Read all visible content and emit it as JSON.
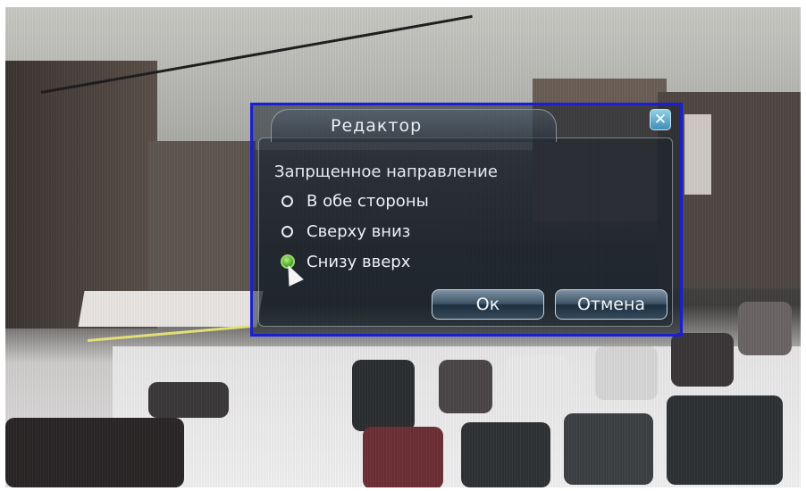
{
  "dialog": {
    "title": "Редактор",
    "close_icon": "close-icon",
    "section_label": "Запрщенное направление",
    "options": [
      {
        "label": "В обе стороны",
        "checked": false
      },
      {
        "label": "Сверху вниз",
        "checked": false
      },
      {
        "label": "Снизу вверх",
        "checked": true
      }
    ],
    "ok_label": "Ок",
    "cancel_label": "Отмена"
  },
  "colors": {
    "dialog_border": "#1a1fd2",
    "radio_checked": "#3f9d25",
    "tripline": "#e7e47a"
  }
}
